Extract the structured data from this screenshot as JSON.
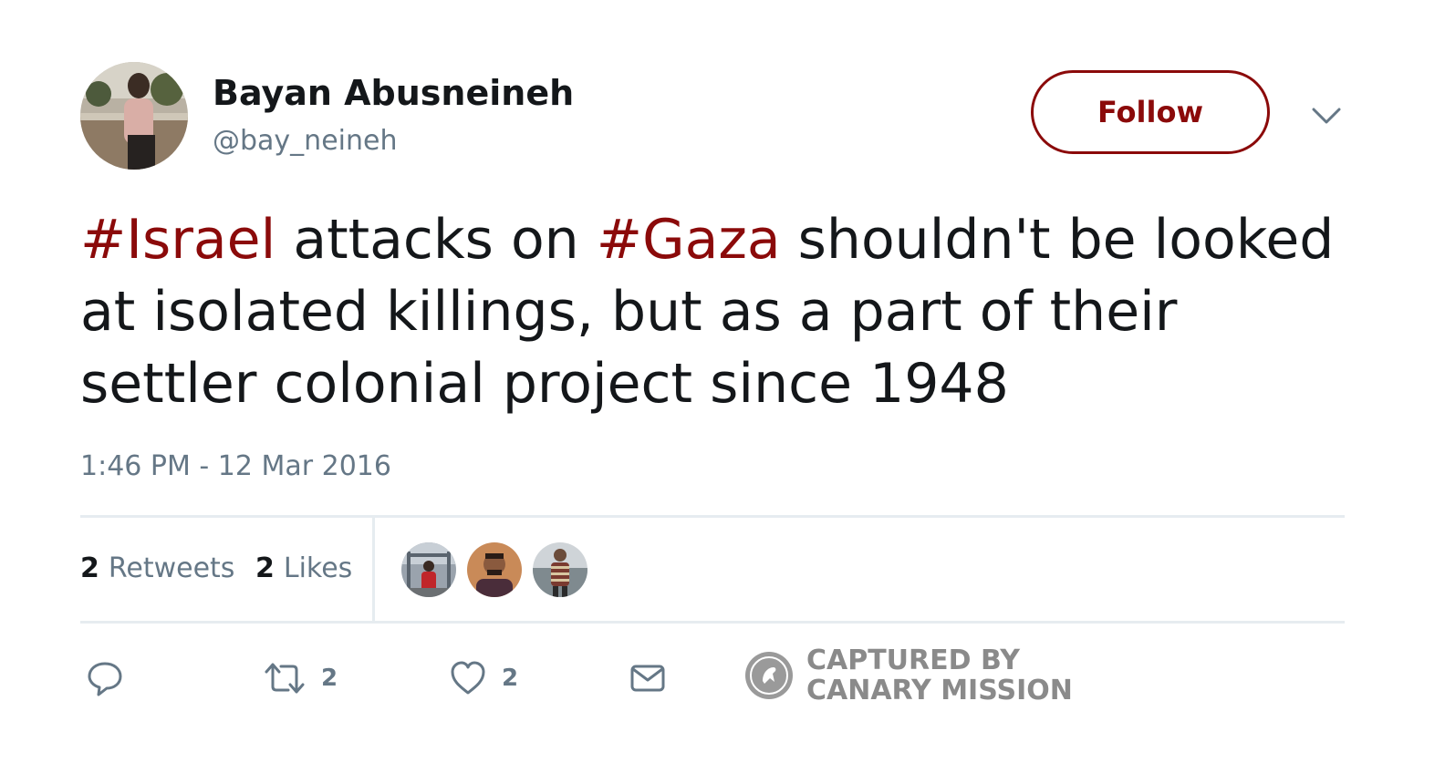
{
  "user": {
    "display_name": "Bayan Abusneineh",
    "handle": "@bay_neineh"
  },
  "header": {
    "follow_label": "Follow"
  },
  "tweet": {
    "segments": [
      {
        "text": "#Israel",
        "hashtag": true
      },
      {
        "text": " attacks on ",
        "hashtag": false
      },
      {
        "text": "#Gaza",
        "hashtag": true
      },
      {
        "text": " shouldn't be looked at isolated killings, but as a part of their settler colonial project since 1948",
        "hashtag": false
      }
    ],
    "timestamp": "1:46 PM - 12 Mar 2016"
  },
  "stats": {
    "retweets_count": "2",
    "retweets_label": "Retweets",
    "likes_count": "2",
    "likes_label": "Likes"
  },
  "actions": {
    "reply_icon": "reply-icon",
    "retweet_icon": "retweet-icon",
    "retweet_count": "2",
    "like_icon": "heart-icon",
    "like_count": "2",
    "dm_icon": "envelope-icon"
  },
  "watermark": {
    "line1": "CAPTURED BY",
    "line2": "CANARY MISSION"
  },
  "colors": {
    "accent": "#8b0a0a",
    "text": "#14171a",
    "muted": "#657786",
    "divider": "#e6ecf0"
  }
}
